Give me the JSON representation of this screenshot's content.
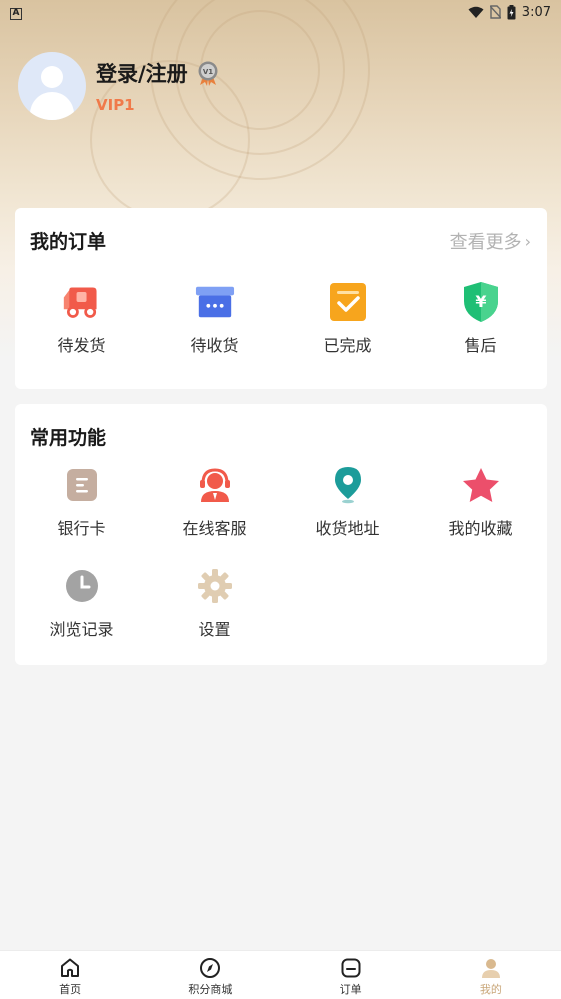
{
  "status_bar": {
    "left_badge": "A",
    "time": "3:07"
  },
  "profile": {
    "login_text": "登录/注册",
    "vip_level": "VIP1"
  },
  "orders": {
    "title": "我的订单",
    "more_label": "查看更多",
    "items": [
      {
        "label": "待发货",
        "icon": "truck-icon"
      },
      {
        "label": "待收货",
        "icon": "package-box-icon"
      },
      {
        "label": "已完成",
        "icon": "check-clipboard-icon"
      },
      {
        "label": "售后",
        "icon": "yen-shield-icon"
      }
    ]
  },
  "functions": {
    "title": "常用功能",
    "items": [
      {
        "label": "银行卡",
        "icon": "bank-card-icon"
      },
      {
        "label": "在线客服",
        "icon": "customer-service-icon"
      },
      {
        "label": "收货地址",
        "icon": "location-pin-icon"
      },
      {
        "label": "我的收藏",
        "icon": "star-icon"
      },
      {
        "label": "浏览记录",
        "icon": "clock-icon"
      },
      {
        "label": "设置",
        "icon": "gear-icon"
      }
    ]
  },
  "tabbar": {
    "items": [
      {
        "label": "首页",
        "icon": "home-icon"
      },
      {
        "label": "积分商城",
        "icon": "compass-icon"
      },
      {
        "label": "订单",
        "icon": "order-icon"
      },
      {
        "label": "我的",
        "icon": "user-icon",
        "active": true
      }
    ],
    "active_color": "#c9a77a"
  },
  "colors": {
    "vip_orange": "#f07a4a",
    "accent_gold": "#c9a77a"
  }
}
